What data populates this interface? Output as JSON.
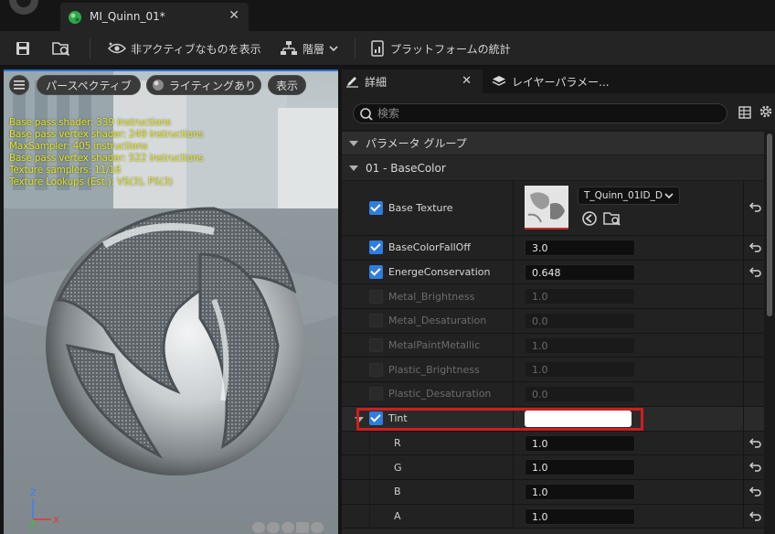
{
  "titlebar": {
    "tab_title": "MI_Quinn_01*",
    "close_symbol": "✕"
  },
  "toolbar": {
    "hide_inactive_label": "非アクティブなものを表示",
    "hierarchy_label": "階層",
    "platform_stats_label": "プラットフォームの統計"
  },
  "viewport": {
    "perspective_label": "パースペクティブ",
    "lighting_label": "ライティングあり",
    "show_label": "表示",
    "stats": [
      "Base pass shader: 339 instructions",
      "Base pass vertex shader: 249 instructions",
      "MaxSampler: 405 instructions",
      "Base pass vertex shader: 522 instructions",
      "Texture samplers: 11/16",
      "Texture Lookups (Est.): VS(3), PS(3)"
    ],
    "axis": {
      "z": "Z",
      "y": "Y",
      "x": "X"
    },
    "stats_color": "#e3e318"
  },
  "details": {
    "tab_details": "詳細",
    "tab_layers": "レイヤーパラメー...",
    "search_placeholder": "検索",
    "group_label": "パラメータ グループ",
    "basecolor_label": "01 - BaseColor",
    "base_texture_label": "Base Texture",
    "base_texture_value": "T_Quinn_01ID_D",
    "params": [
      {
        "label": "BaseColorFallOff",
        "value": "3.0",
        "enabled": true
      },
      {
        "label": "EnergeConservation",
        "value": "0.648",
        "enabled": true
      },
      {
        "label": "Metal_Brightness",
        "value": "1.0",
        "enabled": false
      },
      {
        "label": "Metal_Desaturation",
        "value": "0.0",
        "enabled": false
      },
      {
        "label": "MetalPaintMetallic",
        "value": "1.0",
        "enabled": false
      },
      {
        "label": "Plastic_Brightness",
        "value": "1.0",
        "enabled": false
      },
      {
        "label": "Plastic_Desaturation",
        "value": "0.0",
        "enabled": false
      }
    ],
    "tint_label": "Tint",
    "tint_color": "#ffffff",
    "tint_components": [
      {
        "label": "R",
        "value": "1.0"
      },
      {
        "label": "G",
        "value": "1.0"
      },
      {
        "label": "B",
        "value": "1.0"
      },
      {
        "label": "A",
        "value": "1.0"
      }
    ],
    "highlight_color": "#d01e1e",
    "accent_color": "#2f7de0"
  }
}
